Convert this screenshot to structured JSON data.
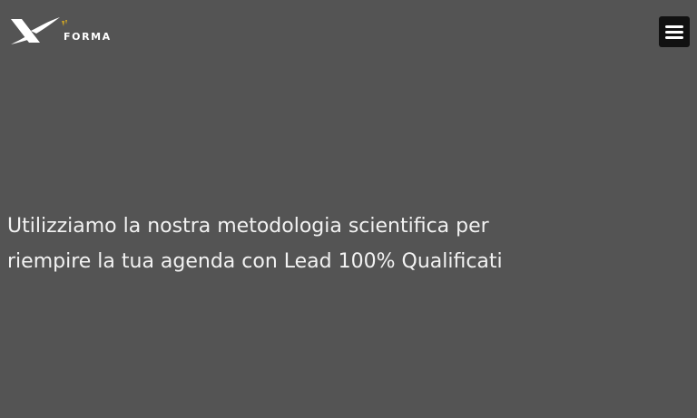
{
  "header": {
    "logo": {
      "text": "FORMA",
      "icon": "x-logo-icon",
      "accent_color": "#c9a227"
    },
    "menu_button": {
      "icon": "hamburger-menu-icon"
    }
  },
  "hero": {
    "line1": "Utilizziamo la nostra metodologia scientifica per",
    "line2": "riempire la tua agenda con Lead 100% Qualificati"
  },
  "colors": {
    "background": "#545454",
    "text": "#f2f2f2",
    "menu_button_bg": "#111111"
  }
}
